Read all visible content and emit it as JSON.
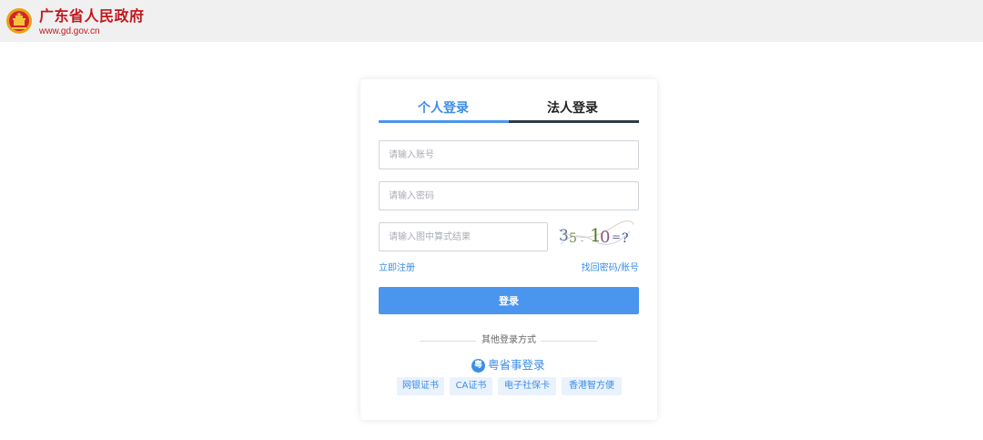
{
  "header": {
    "site_title": "广东省人民政府",
    "site_url": "www.gd.gov.cn",
    "emblem_icon": "national-emblem-icon"
  },
  "login": {
    "tabs": [
      {
        "label": "个人登录",
        "active": true
      },
      {
        "label": "法人登录",
        "active": false
      }
    ],
    "account_placeholder": "请输入账号",
    "password_placeholder": "请输入密码",
    "captcha_placeholder": "请输入图中算式结果",
    "captcha_text": "35 - 10 = ?",
    "register_link": "立即注册",
    "forgot_link": "找回密码/账号",
    "login_button": "登录",
    "other_methods_label": "其他登录方式",
    "yss_icon": "yss-app-icon",
    "yss_label": "粤省事登录",
    "other_methods": [
      "网银证书",
      "CA证书",
      "电子社保卡",
      "香港智方便"
    ]
  },
  "colors": {
    "brand_red": "#c4161c",
    "accent_blue": "#4a95ee",
    "dark_tab_line": "#2f3a45"
  }
}
